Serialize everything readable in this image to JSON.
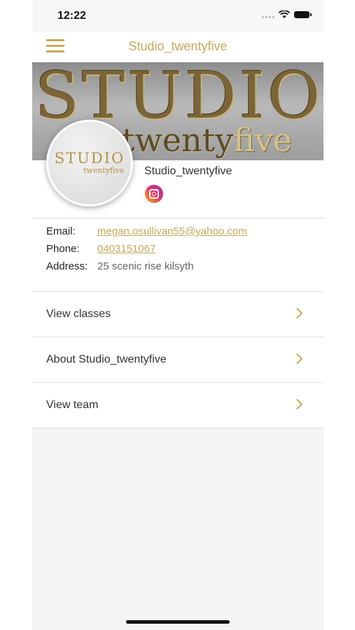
{
  "status_bar": {
    "time": "12:22"
  },
  "header": {
    "title": "Studio_twentyfive"
  },
  "banner": {
    "line1": "STUDIO",
    "line2_part1": "twenty",
    "line2_part2": "five"
  },
  "avatar": {
    "logo_line1": "STUDIO",
    "logo_line2": "twentyfive"
  },
  "profile": {
    "name": "Studio_twentyfive",
    "social_icon": "instagram-icon"
  },
  "contact": {
    "email_label": "Email:",
    "email_value": "megan.osullivan55@yahoo.com",
    "phone_label": "Phone:",
    "phone_value": "0403151067",
    "address_label": "Address:",
    "address_value": "25 scenic rise kilsyth"
  },
  "menu_items": [
    {
      "label": "View classes"
    },
    {
      "label": "About Studio_twentyfive"
    },
    {
      "label": "View team"
    }
  ],
  "colors": {
    "accent": "#c6a85a",
    "background": "#f4f4f4"
  }
}
